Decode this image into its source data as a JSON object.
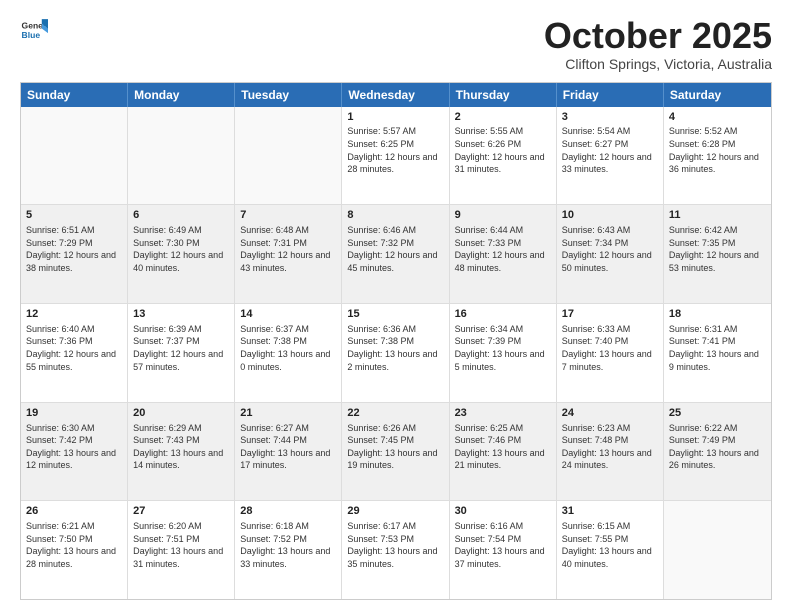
{
  "header": {
    "logo_general": "General",
    "logo_blue": "Blue",
    "month_title": "October 2025",
    "location": "Clifton Springs, Victoria, Australia"
  },
  "days_of_week": [
    "Sunday",
    "Monday",
    "Tuesday",
    "Wednesday",
    "Thursday",
    "Friday",
    "Saturday"
  ],
  "weeks": [
    [
      {
        "day": "",
        "sunrise": "",
        "sunset": "",
        "daylight": "",
        "empty": true
      },
      {
        "day": "",
        "sunrise": "",
        "sunset": "",
        "daylight": "",
        "empty": true
      },
      {
        "day": "",
        "sunrise": "",
        "sunset": "",
        "daylight": "",
        "empty": true
      },
      {
        "day": "1",
        "sunrise": "Sunrise: 5:57 AM",
        "sunset": "Sunset: 6:25 PM",
        "daylight": "Daylight: 12 hours and 28 minutes."
      },
      {
        "day": "2",
        "sunrise": "Sunrise: 5:55 AM",
        "sunset": "Sunset: 6:26 PM",
        "daylight": "Daylight: 12 hours and 31 minutes."
      },
      {
        "day": "3",
        "sunrise": "Sunrise: 5:54 AM",
        "sunset": "Sunset: 6:27 PM",
        "daylight": "Daylight: 12 hours and 33 minutes."
      },
      {
        "day": "4",
        "sunrise": "Sunrise: 5:52 AM",
        "sunset": "Sunset: 6:28 PM",
        "daylight": "Daylight: 12 hours and 36 minutes."
      }
    ],
    [
      {
        "day": "5",
        "sunrise": "Sunrise: 6:51 AM",
        "sunset": "Sunset: 7:29 PM",
        "daylight": "Daylight: 12 hours and 38 minutes."
      },
      {
        "day": "6",
        "sunrise": "Sunrise: 6:49 AM",
        "sunset": "Sunset: 7:30 PM",
        "daylight": "Daylight: 12 hours and 40 minutes."
      },
      {
        "day": "7",
        "sunrise": "Sunrise: 6:48 AM",
        "sunset": "Sunset: 7:31 PM",
        "daylight": "Daylight: 12 hours and 43 minutes."
      },
      {
        "day": "8",
        "sunrise": "Sunrise: 6:46 AM",
        "sunset": "Sunset: 7:32 PM",
        "daylight": "Daylight: 12 hours and 45 minutes."
      },
      {
        "day": "9",
        "sunrise": "Sunrise: 6:44 AM",
        "sunset": "Sunset: 7:33 PM",
        "daylight": "Daylight: 12 hours and 48 minutes."
      },
      {
        "day": "10",
        "sunrise": "Sunrise: 6:43 AM",
        "sunset": "Sunset: 7:34 PM",
        "daylight": "Daylight: 12 hours and 50 minutes."
      },
      {
        "day": "11",
        "sunrise": "Sunrise: 6:42 AM",
        "sunset": "Sunset: 7:35 PM",
        "daylight": "Daylight: 12 hours and 53 minutes."
      }
    ],
    [
      {
        "day": "12",
        "sunrise": "Sunrise: 6:40 AM",
        "sunset": "Sunset: 7:36 PM",
        "daylight": "Daylight: 12 hours and 55 minutes."
      },
      {
        "day": "13",
        "sunrise": "Sunrise: 6:39 AM",
        "sunset": "Sunset: 7:37 PM",
        "daylight": "Daylight: 12 hours and 57 minutes."
      },
      {
        "day": "14",
        "sunrise": "Sunrise: 6:37 AM",
        "sunset": "Sunset: 7:38 PM",
        "daylight": "Daylight: 13 hours and 0 minutes."
      },
      {
        "day": "15",
        "sunrise": "Sunrise: 6:36 AM",
        "sunset": "Sunset: 7:38 PM",
        "daylight": "Daylight: 13 hours and 2 minutes."
      },
      {
        "day": "16",
        "sunrise": "Sunrise: 6:34 AM",
        "sunset": "Sunset: 7:39 PM",
        "daylight": "Daylight: 13 hours and 5 minutes."
      },
      {
        "day": "17",
        "sunrise": "Sunrise: 6:33 AM",
        "sunset": "Sunset: 7:40 PM",
        "daylight": "Daylight: 13 hours and 7 minutes."
      },
      {
        "day": "18",
        "sunrise": "Sunrise: 6:31 AM",
        "sunset": "Sunset: 7:41 PM",
        "daylight": "Daylight: 13 hours and 9 minutes."
      }
    ],
    [
      {
        "day": "19",
        "sunrise": "Sunrise: 6:30 AM",
        "sunset": "Sunset: 7:42 PM",
        "daylight": "Daylight: 13 hours and 12 minutes."
      },
      {
        "day": "20",
        "sunrise": "Sunrise: 6:29 AM",
        "sunset": "Sunset: 7:43 PM",
        "daylight": "Daylight: 13 hours and 14 minutes."
      },
      {
        "day": "21",
        "sunrise": "Sunrise: 6:27 AM",
        "sunset": "Sunset: 7:44 PM",
        "daylight": "Daylight: 13 hours and 17 minutes."
      },
      {
        "day": "22",
        "sunrise": "Sunrise: 6:26 AM",
        "sunset": "Sunset: 7:45 PM",
        "daylight": "Daylight: 13 hours and 19 minutes."
      },
      {
        "day": "23",
        "sunrise": "Sunrise: 6:25 AM",
        "sunset": "Sunset: 7:46 PM",
        "daylight": "Daylight: 13 hours and 21 minutes."
      },
      {
        "day": "24",
        "sunrise": "Sunrise: 6:23 AM",
        "sunset": "Sunset: 7:48 PM",
        "daylight": "Daylight: 13 hours and 24 minutes."
      },
      {
        "day": "25",
        "sunrise": "Sunrise: 6:22 AM",
        "sunset": "Sunset: 7:49 PM",
        "daylight": "Daylight: 13 hours and 26 minutes."
      }
    ],
    [
      {
        "day": "26",
        "sunrise": "Sunrise: 6:21 AM",
        "sunset": "Sunset: 7:50 PM",
        "daylight": "Daylight: 13 hours and 28 minutes."
      },
      {
        "day": "27",
        "sunrise": "Sunrise: 6:20 AM",
        "sunset": "Sunset: 7:51 PM",
        "daylight": "Daylight: 13 hours and 31 minutes."
      },
      {
        "day": "28",
        "sunrise": "Sunrise: 6:18 AM",
        "sunset": "Sunset: 7:52 PM",
        "daylight": "Daylight: 13 hours and 33 minutes."
      },
      {
        "day": "29",
        "sunrise": "Sunrise: 6:17 AM",
        "sunset": "Sunset: 7:53 PM",
        "daylight": "Daylight: 13 hours and 35 minutes."
      },
      {
        "day": "30",
        "sunrise": "Sunrise: 6:16 AM",
        "sunset": "Sunset: 7:54 PM",
        "daylight": "Daylight: 13 hours and 37 minutes."
      },
      {
        "day": "31",
        "sunrise": "Sunrise: 6:15 AM",
        "sunset": "Sunset: 7:55 PM",
        "daylight": "Daylight: 13 hours and 40 minutes."
      },
      {
        "day": "",
        "sunrise": "",
        "sunset": "",
        "daylight": "",
        "empty": true
      }
    ]
  ]
}
